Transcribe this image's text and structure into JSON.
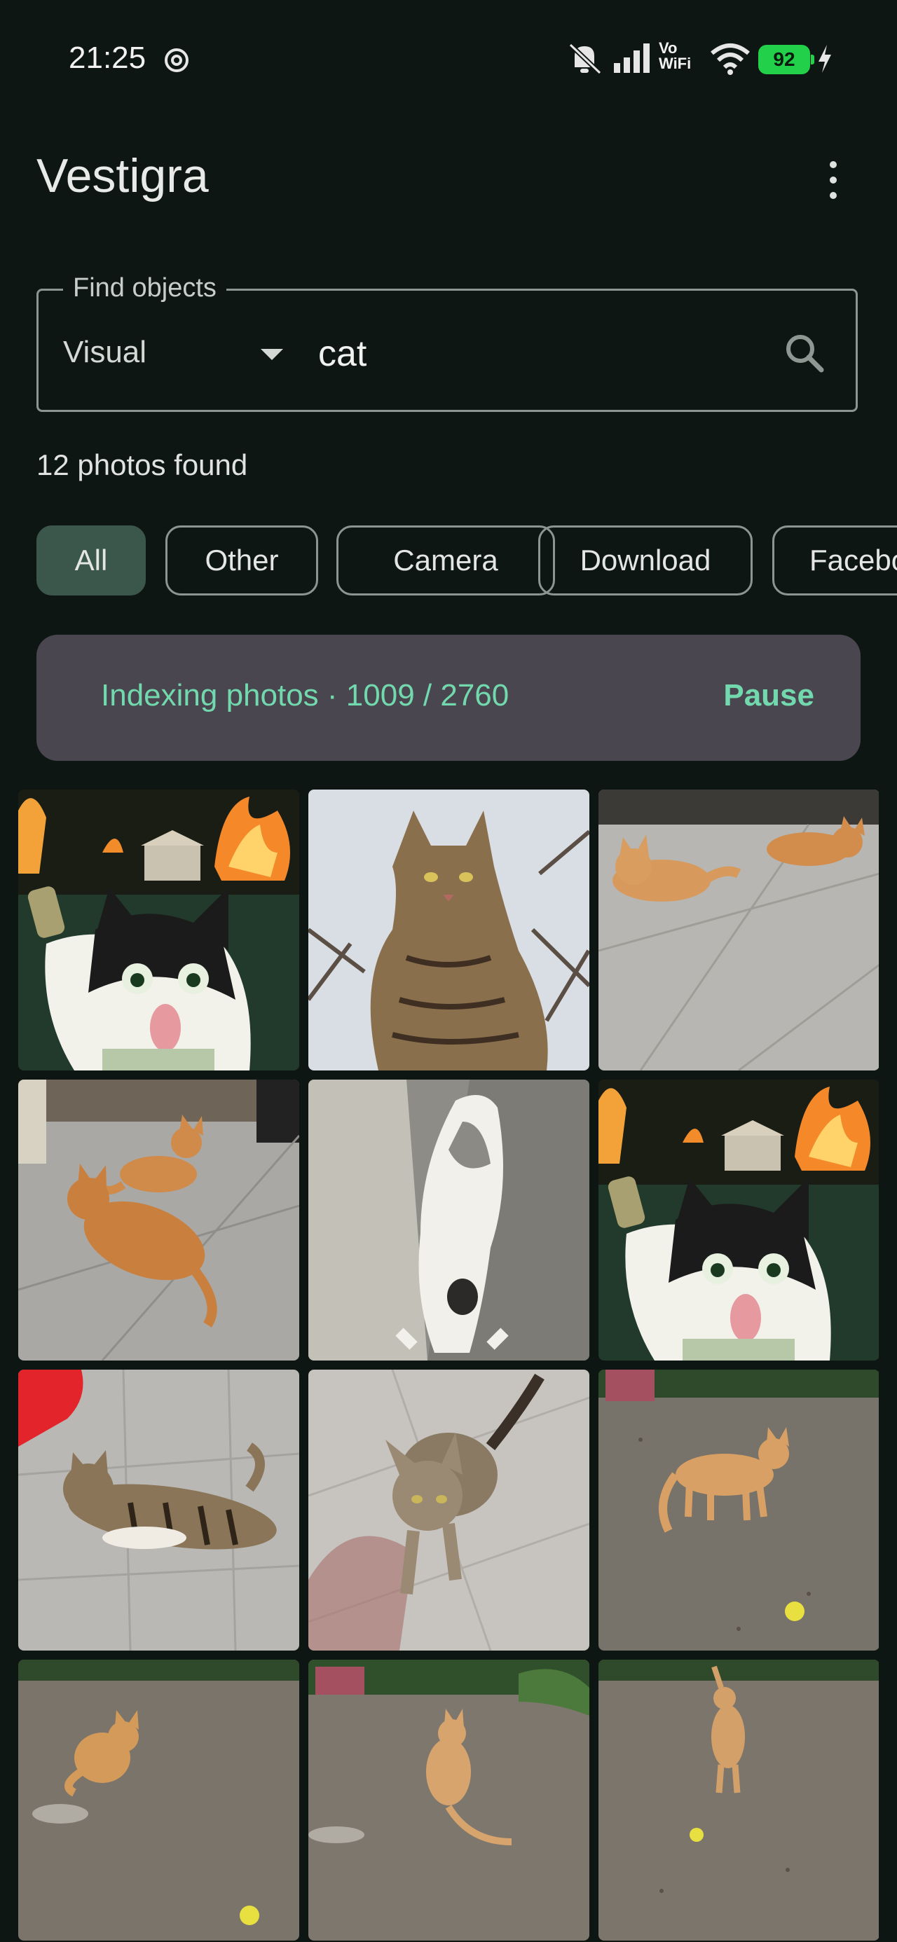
{
  "status_bar": {
    "time": "21:25",
    "network_label": "Vo\nWiFi",
    "battery_level": "92",
    "icons": [
      "chatgpt-icon",
      "bell-off-icon",
      "signal-icon",
      "wifi-icon",
      "charging-icon"
    ]
  },
  "app": {
    "title": "Vestigra"
  },
  "search": {
    "legend": "Find objects",
    "mode": "Visual",
    "query": "cat"
  },
  "results": {
    "count_text": "12 photos found"
  },
  "chips": [
    {
      "label": "All",
      "selected": true
    },
    {
      "label": "Other",
      "selected": false
    },
    {
      "label": "Camera",
      "selected": false
    },
    {
      "label": "Download",
      "selected": false
    },
    {
      "label": "Facebook",
      "selected": false
    }
  ],
  "indexing": {
    "text": "Indexing photos · 1009 / 2760",
    "action": "Pause"
  },
  "colors": {
    "background": "#0e1614",
    "accent": "#72d8ad",
    "chip_selected": "#3b564b",
    "banner": "#49464f",
    "battery": "#22d04a"
  },
  "photos": [
    {
      "subject": "black-and-white kitten meme with fire background"
    },
    {
      "subject": "tabby cat sitting against sky"
    },
    {
      "subject": "two orange cats lying on tile floor"
    },
    {
      "subject": "two orange cats lying on tile floor"
    },
    {
      "subject": "white cat stretching against wall"
    },
    {
      "subject": "black-and-white kitten meme with fire background"
    },
    {
      "subject": "tabby cat lying on tile floor"
    },
    {
      "subject": "tabby cat walking on tile floor"
    },
    {
      "subject": "orange kitten walking on dirt"
    },
    {
      "subject": "orange kitten sitting on dirt"
    },
    {
      "subject": "orange kitten sitting on dirt"
    },
    {
      "subject": "orange kitten walking on dirt"
    }
  ]
}
